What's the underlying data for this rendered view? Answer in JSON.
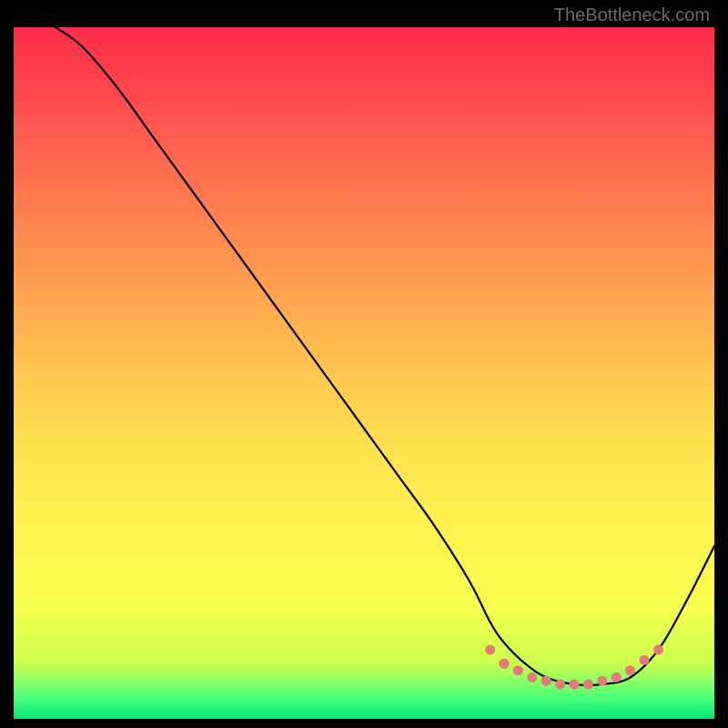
{
  "watermark": "TheBottleneck.com",
  "chart_data": {
    "type": "line",
    "title": "",
    "xlabel": "",
    "ylabel": "",
    "xlim": [
      0,
      100
    ],
    "ylim": [
      0,
      100
    ],
    "x": [
      0,
      3,
      6,
      10,
      15,
      20,
      25,
      30,
      35,
      40,
      45,
      50,
      55,
      60,
      65,
      68,
      70,
      73,
      76,
      80,
      84,
      88,
      92,
      96,
      100
    ],
    "y": [
      106,
      102,
      100,
      97,
      91,
      84,
      77,
      70,
      63,
      56,
      49,
      42,
      35,
      28,
      20,
      14,
      11,
      8,
      6,
      5,
      5,
      6,
      10,
      17,
      25
    ],
    "markers": {
      "x": [
        68,
        70,
        72,
        74,
        76,
        78,
        80,
        82,
        84,
        86,
        88,
        90,
        92
      ],
      "y": [
        10,
        8,
        7,
        6,
        5.5,
        5,
        5,
        5,
        5.5,
        6,
        7,
        8.5,
        10
      ],
      "color": "#e67a7a"
    },
    "curve_color": "#000000",
    "background_gradient": "red-to-green"
  }
}
